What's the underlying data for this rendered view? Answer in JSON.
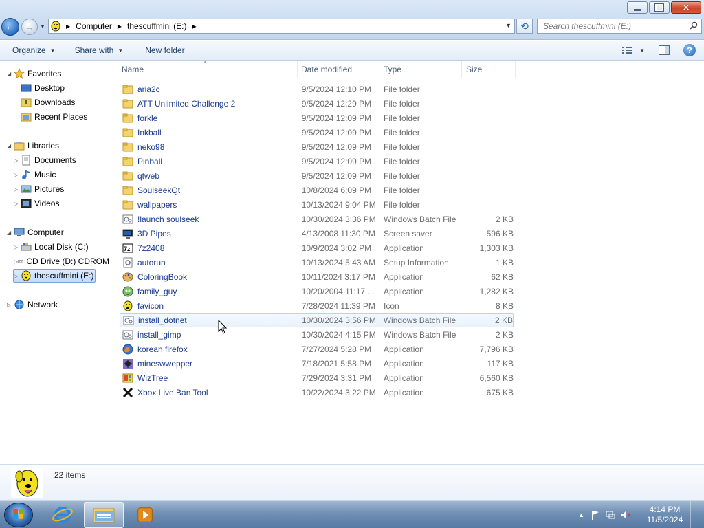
{
  "address": {
    "crumbs": [
      "Computer",
      "thescuffmini (E:)"
    ]
  },
  "search": {
    "placeholder": "Search thescuffmini (E:)"
  },
  "toolbar": {
    "organize": "Organize",
    "share_with": "Share with",
    "new_folder": "New folder"
  },
  "nav": {
    "favorites": "Favorites",
    "desktop": "Desktop",
    "downloads": "Downloads",
    "recent_places": "Recent Places",
    "libraries": "Libraries",
    "documents": "Documents",
    "music": "Music",
    "pictures": "Pictures",
    "videos": "Videos",
    "computer": "Computer",
    "local_disk": "Local Disk (C:)",
    "cd_drive": "CD Drive (D:) CDROM",
    "thescuffmini": "thescuffmini (E:)",
    "network": "Network"
  },
  "columns": {
    "name": "Name",
    "date_modified": "Date modified",
    "type": "Type",
    "size": "Size"
  },
  "files": [
    {
      "name": "aria2c",
      "date": "9/5/2024 12:10 PM",
      "type": "File folder",
      "size": "",
      "icon": "folder-icon"
    },
    {
      "name": "ATT Unlimited Challenge 2",
      "date": "9/5/2024 12:29 PM",
      "type": "File folder",
      "size": "",
      "icon": "folder-icon"
    },
    {
      "name": "forkle",
      "date": "9/5/2024 12:09 PM",
      "type": "File folder",
      "size": "",
      "icon": "folder-icon"
    },
    {
      "name": "Inkball",
      "date": "9/5/2024 12:09 PM",
      "type": "File folder",
      "size": "",
      "icon": "folder-icon"
    },
    {
      "name": "neko98",
      "date": "9/5/2024 12:09 PM",
      "type": "File folder",
      "size": "",
      "icon": "folder-icon"
    },
    {
      "name": "Pinball",
      "date": "9/5/2024 12:09 PM",
      "type": "File folder",
      "size": "",
      "icon": "folder-icon"
    },
    {
      "name": "qtweb",
      "date": "9/5/2024 12:09 PM",
      "type": "File folder",
      "size": "",
      "icon": "folder-icon"
    },
    {
      "name": "SoulseekQt",
      "date": "10/8/2024 6:09 PM",
      "type": "File folder",
      "size": "",
      "icon": "folder-icon"
    },
    {
      "name": "wallpapers",
      "date": "10/13/2024 9:04 PM",
      "type": "File folder",
      "size": "",
      "icon": "folder-icon"
    },
    {
      "name": "!launch soulseek",
      "date": "10/30/2024 3:36 PM",
      "type": "Windows Batch File",
      "size": "2 KB",
      "icon": "batch-file-icon"
    },
    {
      "name": "3D Pipes",
      "date": "4/13/2008 11:30 PM",
      "type": "Screen saver",
      "size": "596 KB",
      "icon": "screensaver-icon"
    },
    {
      "name": "7z2408",
      "date": "10/9/2024 3:02 PM",
      "type": "Application",
      "size": "1,303 KB",
      "icon": "7zip-icon"
    },
    {
      "name": "autorun",
      "date": "10/13/2024 5:43 AM",
      "type": "Setup Information",
      "size": "1 KB",
      "icon": "setup-info-icon"
    },
    {
      "name": "ColoringBook",
      "date": "10/11/2024 3:17 PM",
      "type": "Application",
      "size": "62 KB",
      "icon": "palette-icon"
    },
    {
      "name": "family_guy",
      "date": "10/20/2004 11:17 ...",
      "type": "Application",
      "size": "1,282 KB",
      "icon": "family-guy-icon"
    },
    {
      "name": "favicon",
      "date": "7/28/2024 11:39 PM",
      "type": "Icon",
      "size": "8 KB",
      "icon": "dog-icon"
    },
    {
      "name": "install_dotnet",
      "date": "10/30/2024 3:56 PM",
      "type": "Windows Batch File",
      "size": "2 KB",
      "icon": "batch-file-icon"
    },
    {
      "name": "install_gimp",
      "date": "10/30/2024 4:15 PM",
      "type": "Windows Batch File",
      "size": "2 KB",
      "icon": "batch-file-icon"
    },
    {
      "name": "korean firefox",
      "date": "7/27/2024 5:28 PM",
      "type": "Application",
      "size": "7,796 KB",
      "icon": "firefox-icon"
    },
    {
      "name": "mineswwepper",
      "date": "7/18/2021 5:58 PM",
      "type": "Application",
      "size": "117 KB",
      "icon": "minesweeper-icon"
    },
    {
      "name": "WizTree",
      "date": "7/29/2024 3:31 PM",
      "type": "Application",
      "size": "6,560 KB",
      "icon": "wiztree-icon"
    },
    {
      "name": "Xbox Live Ban Tool",
      "date": "10/22/2024 3:22 PM",
      "type": "Application",
      "size": "675 KB",
      "icon": "x-icon"
    }
  ],
  "details": {
    "count": "22 items"
  },
  "clock": {
    "time": "4:14 PM",
    "date": "11/5/2024"
  }
}
